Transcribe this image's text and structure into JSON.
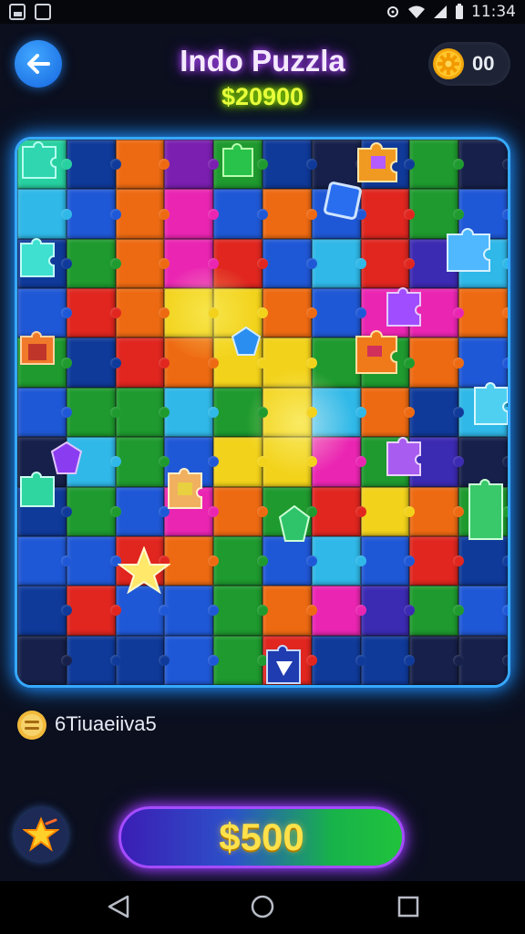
{
  "status_bar": {
    "time": "11:34"
  },
  "header": {
    "title": "Indo Puzzla",
    "score": "$20900"
  },
  "coins": {
    "value": "00"
  },
  "board": {
    "palette": [
      "#1e9a2e",
      "#1f58d6",
      "#e0261f",
      "#ee6a12",
      "#f2d21a",
      "#ea25b2",
      "#2fb8e8",
      "#3b2ab2",
      "#27d0a0",
      "#0f3a9a",
      "#7a1fb0",
      "#16204a"
    ]
  },
  "rank": {
    "label": "6Tiuaeiiva5"
  },
  "actions": {
    "buy_label": "$500"
  },
  "colors": {
    "accent_blue": "#36a9ff",
    "title_glow": "#b24bff",
    "score_color": "#e8ff3a",
    "buy_text": "#ffe14a"
  }
}
